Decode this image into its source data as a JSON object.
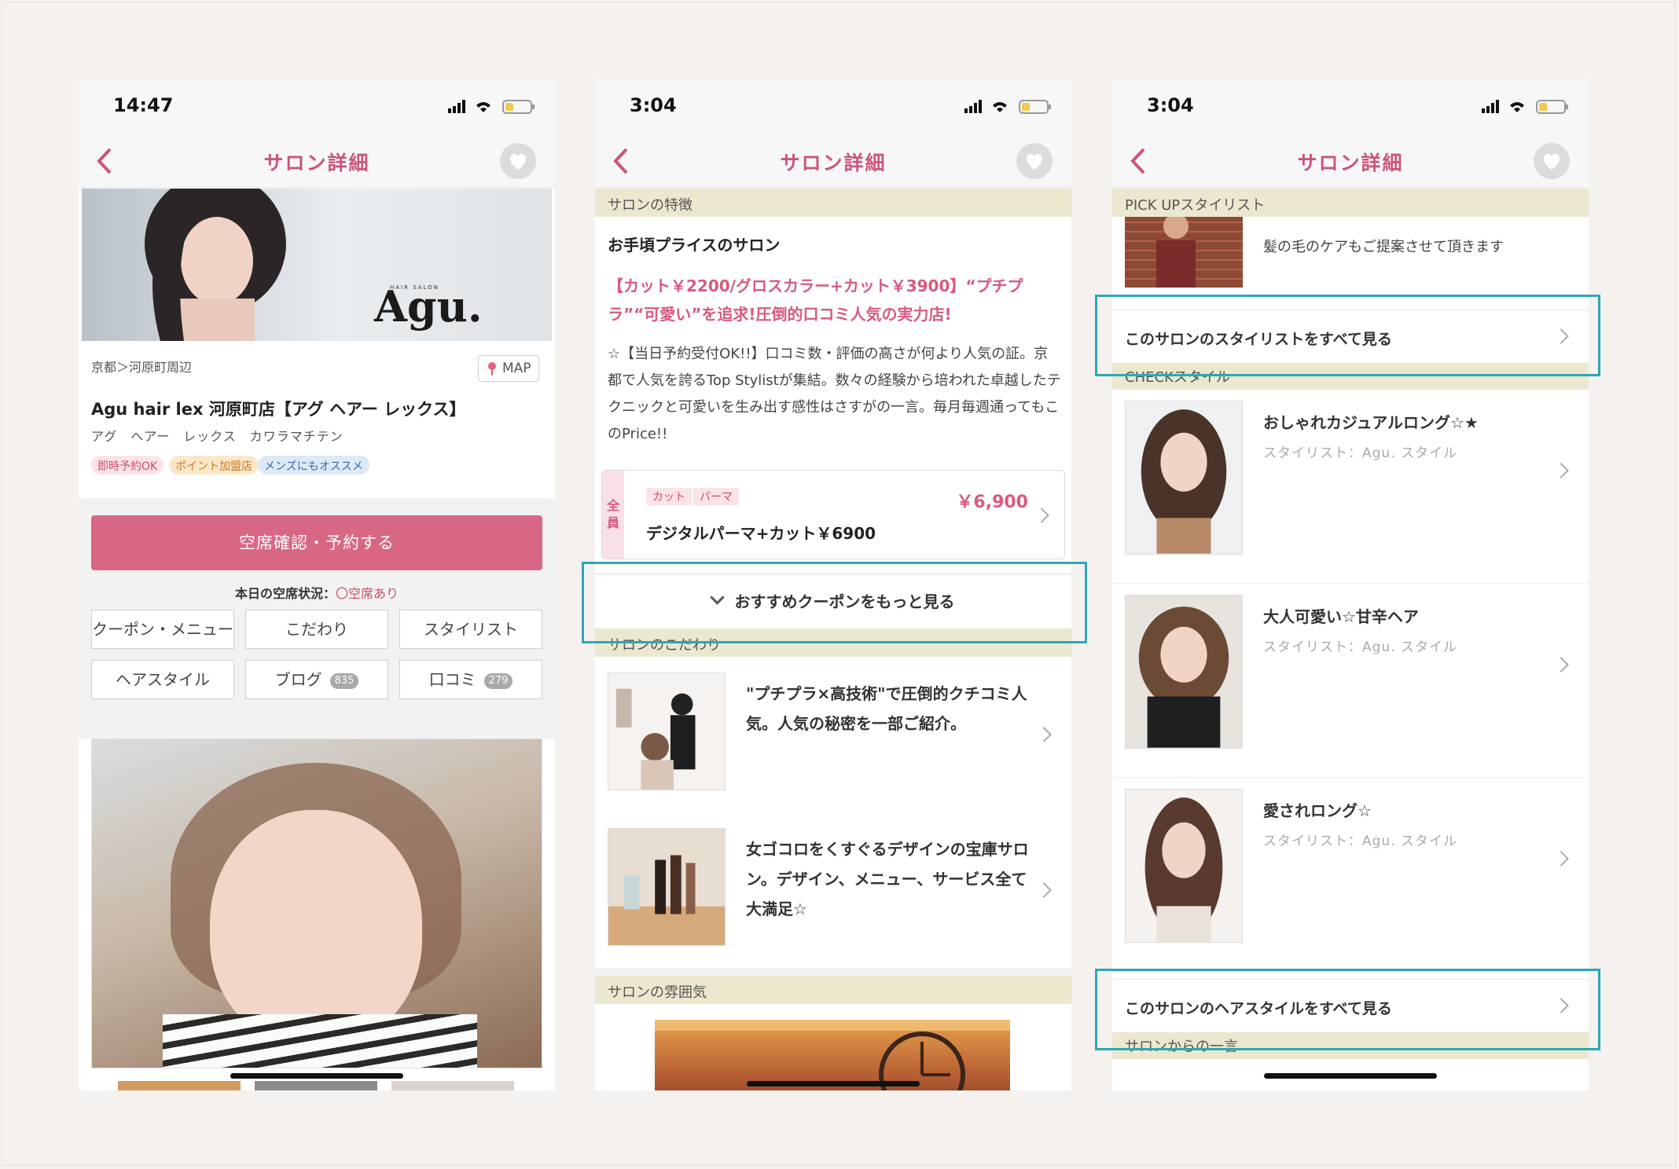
{
  "phones": [
    {
      "time": "14:47",
      "nav_title": "サロン詳細",
      "hero_logo_text": "Agu.",
      "hero_logo_small": "HAIR SALON",
      "breadcrumb": "京都＞河原町周辺",
      "map_label": "MAP",
      "salon_name": "Agu hair lex 河原町店【アグ ヘアー レックス】",
      "salon_kana": "アグ　ヘアー　レックス　カワラマチテン",
      "tags": [
        "即時予約OK",
        "ポイント加盟店",
        "メンズにもオススメ"
      ],
      "reserve_label": "空席確認・予約する",
      "vacancy_label": "本日の空席状況：",
      "vacancy_value": "〇空席あり",
      "menu_buttons": [
        {
          "label": "クーポン・メニュー"
        },
        {
          "label": "こだわり"
        },
        {
          "label": "スタイリスト"
        },
        {
          "label": "ヘアスタイル"
        },
        {
          "label": "ブログ",
          "badge": "835"
        },
        {
          "label": "口コミ",
          "badge": "279"
        }
      ]
    },
    {
      "time": "3:04",
      "nav_title": "サロン詳細",
      "section_feature": "サロンの特徴",
      "feature_title": "お手頃プライスのサロン",
      "feature_catch": "【カット￥2200/グロスカラー+カット￥3900】“プチプラ”“可愛い”を追求!圧倒的口コミ人気の実力店!",
      "feature_body": "☆【当日予約受付OK!!】口コミ数・評価の高さが何より人気の証。京都で人気を誇るTop Stylistが集結。数々の経験から培われた卓越したテクニックと可愛いを生み出す感性はさすがの一言。毎月毎週通ってもこのPrice!!",
      "coupon": {
        "side_label": "全員",
        "tags": [
          "カット",
          "パーマ"
        ],
        "price": "￥6,900",
        "name": "デジタルパーマ+カット￥6900"
      },
      "more_coupon_label": "おすすめクーポンをもっと見る",
      "section_kodawari": "サロンのこだわり",
      "features": [
        {
          "text": "\"プチプラ×高技術\"で圧倒的クチコミ人気。人気の秘密を一部ご紹介。"
        },
        {
          "text": "女ゴコロをくすぐるデザインの宝庫サロン。デザイン、メニュー、サービス全て大満足☆"
        }
      ],
      "section_atmosphere": "サロンの雰囲気"
    },
    {
      "time": "3:04",
      "nav_title": "サロン詳細",
      "section_pickup": "PICK UPスタイリスト",
      "pickup_text": "髪の毛のケアもご提案させて頂きます",
      "see_all_stylists": "このサロンのスタイリストをすべて見る",
      "section_check": "CHECKスタイル",
      "styles": [
        {
          "name": "おしゃれカジュアルロング☆★",
          "stylist": "スタイリスト：Agu. スタイル"
        },
        {
          "name": "大人可愛い☆甘辛ヘア",
          "stylist": "スタイリスト：Agu. スタイル"
        },
        {
          "name": "愛されロング☆",
          "stylist": "スタイリスト：Agu. スタイル"
        }
      ],
      "see_all_styles": "このサロンのヘアスタイルをすべて見る",
      "section_message": "サロンからの一言"
    }
  ],
  "colors": {
    "accent_pink": "#d86786",
    "title_pink": "#c9567a",
    "section_band": "#ece7cf",
    "highlight_teal": "#2ba9b3",
    "background": "#f4f1ef"
  }
}
